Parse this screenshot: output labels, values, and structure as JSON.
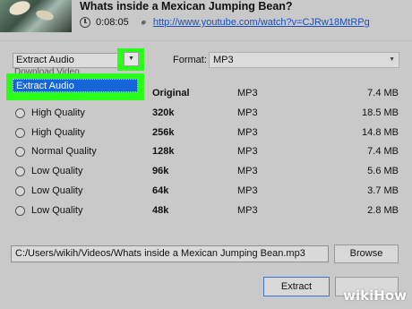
{
  "header": {
    "title": "Whats inside a Mexican Jumping Bean?",
    "duration": "0:08:05",
    "url": "http://www.youtube.com/watch?v=CJRw18MtRPg",
    "icons": {
      "clock": "clock-icon",
      "link": "link-icon"
    }
  },
  "mode": {
    "selected": "Extract Audio",
    "peek": "Download Video",
    "dropdown_options": [
      "Extract Audio"
    ],
    "highlight_color": "#2aff1a",
    "selection_color": "#1565d8"
  },
  "format": {
    "label": "Format:",
    "selected": "MP3"
  },
  "qualities": [
    {
      "quality": "",
      "bitrate": "Original",
      "format": "MP3",
      "size": "7.4 MB"
    },
    {
      "quality": "High Quality",
      "bitrate": "320k",
      "format": "MP3",
      "size": "18.5 MB"
    },
    {
      "quality": "High Quality",
      "bitrate": "256k",
      "format": "MP3",
      "size": "14.8 MB"
    },
    {
      "quality": "Normal Quality",
      "bitrate": "128k",
      "format": "MP3",
      "size": "7.4 MB"
    },
    {
      "quality": "Low Quality",
      "bitrate": "96k",
      "format": "MP3",
      "size": "5.6 MB"
    },
    {
      "quality": "Low Quality",
      "bitrate": "64k",
      "format": "MP3",
      "size": "3.7 MB"
    },
    {
      "quality": "Low Quality",
      "bitrate": "48k",
      "format": "MP3",
      "size": "2.8 MB"
    }
  ],
  "output": {
    "path": "C:/Users/wikih/Videos/Whats inside a Mexican Jumping Bean.mp3",
    "browse_label": "Browse",
    "extract_label": "Extract",
    "cancel_label": ""
  },
  "watermark": {
    "wiki": "wiki",
    "how": "How"
  }
}
